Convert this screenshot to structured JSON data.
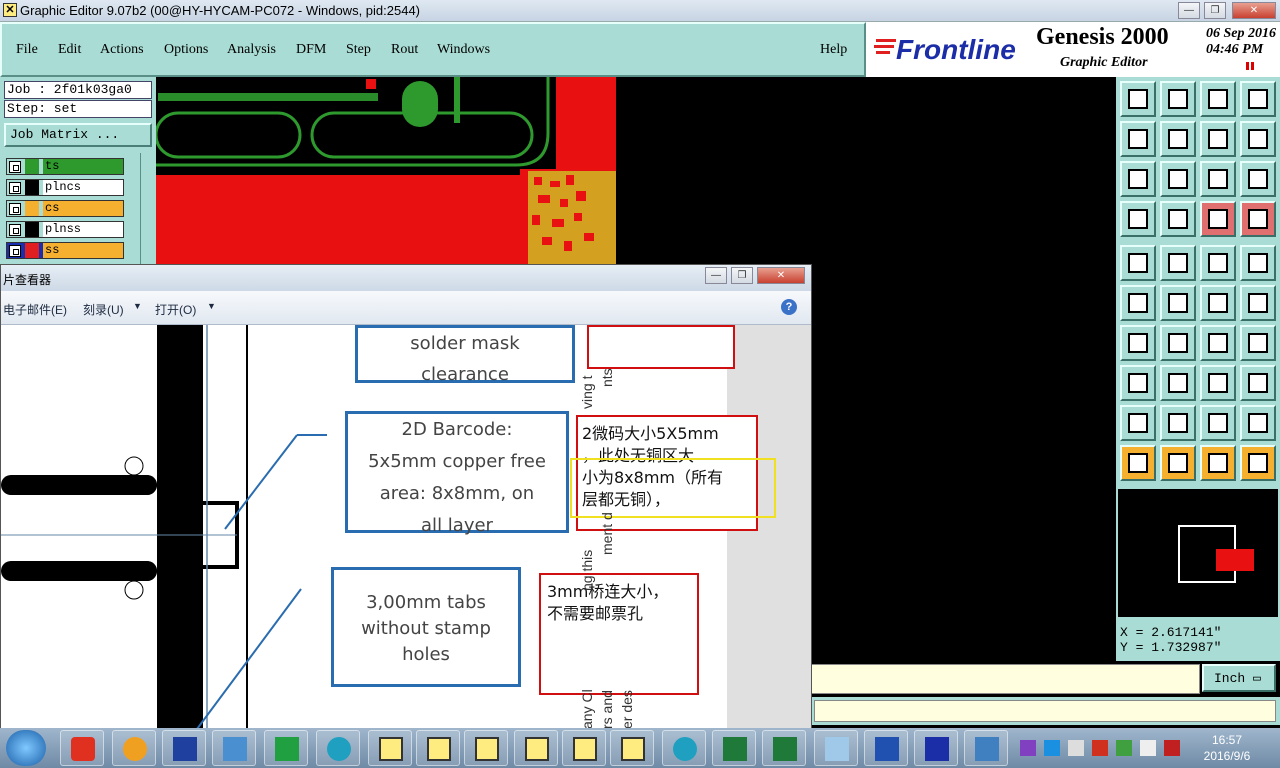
{
  "window": {
    "title": "Graphic Editor 9.07b2 (00@HY-HYCAM-PC072 - Windows, pid:2544)",
    "min": "—",
    "max": "❐",
    "close": "✕"
  },
  "menu": {
    "items": [
      "File",
      "Edit",
      "Actions",
      "Options",
      "Analysis",
      "DFM",
      "Step",
      "Rout",
      "Windows"
    ],
    "help": "Help"
  },
  "brand": {
    "logo": "Frontline",
    "product": "Genesis 2000",
    "subtitle": "Graphic Editor",
    "date": "06  Sep  2016",
    "time": "04:46  PM"
  },
  "job": {
    "job_line": "Job : 2f01k03ga0",
    "step_line": "Step: set",
    "matrix_button": "Job Matrix ..."
  },
  "layers": [
    {
      "name": "ts",
      "color": "#2e9a2e",
      "bg": "#2e9a2e"
    },
    {
      "name": "plncs",
      "color": "#000000",
      "bg": "#ffffff"
    },
    {
      "name": "cs",
      "color": "#f5b030",
      "bg": "#f5b030"
    },
    {
      "name": "plnss",
      "color": "#000000",
      "bg": "#ffffff"
    },
    {
      "name": "ss",
      "color": "#e02020",
      "bg": "#f5b030"
    }
  ],
  "coords": {
    "x": "X = 2.617141\"",
    "y": "Y = 1.732987\""
  },
  "units": "Inch",
  "viewer": {
    "title": "片查看器",
    "toolbar": [
      "电子邮件(E)",
      "刻录(U)",
      "打开(O)"
    ],
    "help": "?",
    "boxes": {
      "solder": [
        "solder mask",
        "clearance"
      ],
      "barcode": [
        "2D Barcode:",
        "5x5mm copper free",
        "area: 8x8mm, on",
        "all layer"
      ],
      "tabs": [
        "3,00mm tabs",
        "without stamp",
        "holes"
      ]
    },
    "notes": {
      "barcode_cn": [
        "2微码大小5X5mm",
        "，此处无铜区大",
        "小为8x8mm（所有",
        "层都无铜），"
      ],
      "tabs_cn": [
        "3mm桥连大小，",
        "不需要邮票孔"
      ]
    },
    "vertical_text": [
      "ving t",
      "nts",
      "ng this",
      "ment d",
      "any Cl",
      "rs and",
      "er des"
    ]
  },
  "taskbar": {
    "time": "16:57",
    "date": "2016/9/6"
  }
}
